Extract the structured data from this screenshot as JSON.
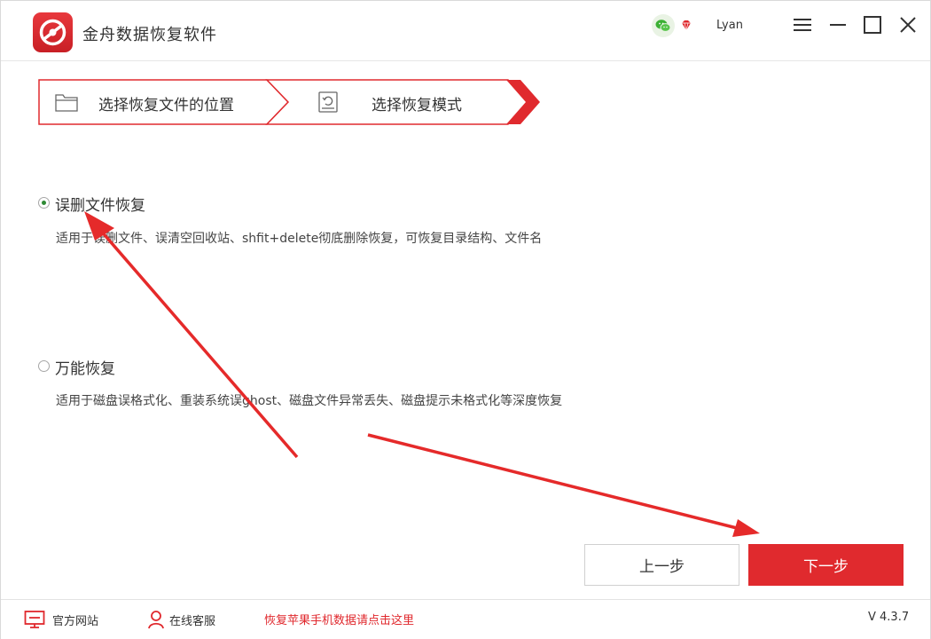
{
  "app": {
    "title": "金舟数据恢复软件",
    "user_name": "Lyan",
    "accent": "#e02a2e"
  },
  "steps": [
    {
      "label": "选择恢复文件的位置",
      "icon": "folder-icon"
    },
    {
      "label": "选择恢复模式",
      "icon": "restore-disk-icon"
    }
  ],
  "options": [
    {
      "title": "误删文件恢复",
      "description": "适用于误删文件、误清空回收站、shfit+delete彻底删除恢复，可恢复目录结构、文件名",
      "selected": true
    },
    {
      "title": "万能恢复",
      "description": "适用于磁盘误格式化、重装系统误ghost、磁盘文件异常丢失、磁盘提示未格式化等深度恢复",
      "selected": false
    }
  ],
  "buttons": {
    "prev": "上一步",
    "next": "下一步"
  },
  "footer": {
    "website": "官方网站",
    "support": "在线客服",
    "apple_link": "恢复苹果手机数据请点击这里",
    "version": "V 4.3.7"
  }
}
